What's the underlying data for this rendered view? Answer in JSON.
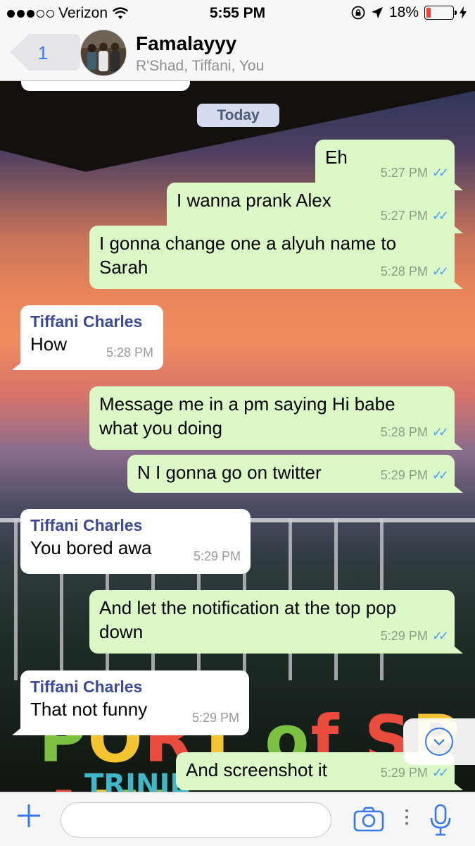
{
  "status_bar": {
    "carrier": "Verizon",
    "time": "5:55 PM",
    "battery": "18%",
    "battery_level": 0.18
  },
  "header": {
    "back_count": "1",
    "title": "Famalayyy",
    "members": "R'Shad, Tiffani, You"
  },
  "date_divider": "Today",
  "messages": [
    {
      "dir": "out",
      "text": "Eh",
      "time": "5:27 PM"
    },
    {
      "dir": "out",
      "text": "I wanna prank Alex",
      "time": "5:27 PM"
    },
    {
      "dir": "out",
      "text": "I gonna change one a alyuh name to Sarah",
      "time": "5:28 PM"
    },
    {
      "dir": "in",
      "sender": "Tiffani Charles",
      "text": "How",
      "time": "5:28 PM"
    },
    {
      "dir": "out",
      "text": "Message me in a pm saying Hi babe what you doing",
      "time": "5:28 PM"
    },
    {
      "dir": "out",
      "text": "N I gonna go on twitter",
      "time": "5:29 PM"
    },
    {
      "dir": "in",
      "sender": "Tiffani Charles",
      "text": "You bored awa",
      "time": "5:29 PM"
    },
    {
      "dir": "out",
      "text": "And let the notification at the top pop down",
      "time": "5:29 PM"
    },
    {
      "dir": "in",
      "sender": "Tiffani Charles",
      "text": "That not funny",
      "time": "5:29 PM"
    },
    {
      "dir": "out",
      "text": "And screenshot it",
      "time": "5:29 PM"
    }
  ],
  "background_sign": {
    "line1": "PORT of SPAIN",
    "line2": "TRINID"
  },
  "colors": {
    "accent": "#3478f6",
    "outgoing_bubble": "#dcf8c6",
    "incoming_bubble": "#ffffff",
    "sender_name": "#3d4a9a",
    "read_ticks": "#4fa3f7"
  },
  "icons": {
    "signal": "signal-dots-icon",
    "wifi": "wifi-icon",
    "lock": "rotation-lock-icon",
    "location": "location-arrow-icon",
    "charging": "bolt-icon",
    "scroll_down": "chevron-down-icon",
    "attach": "plus-icon",
    "camera": "camera-icon",
    "mic": "microphone-icon"
  }
}
